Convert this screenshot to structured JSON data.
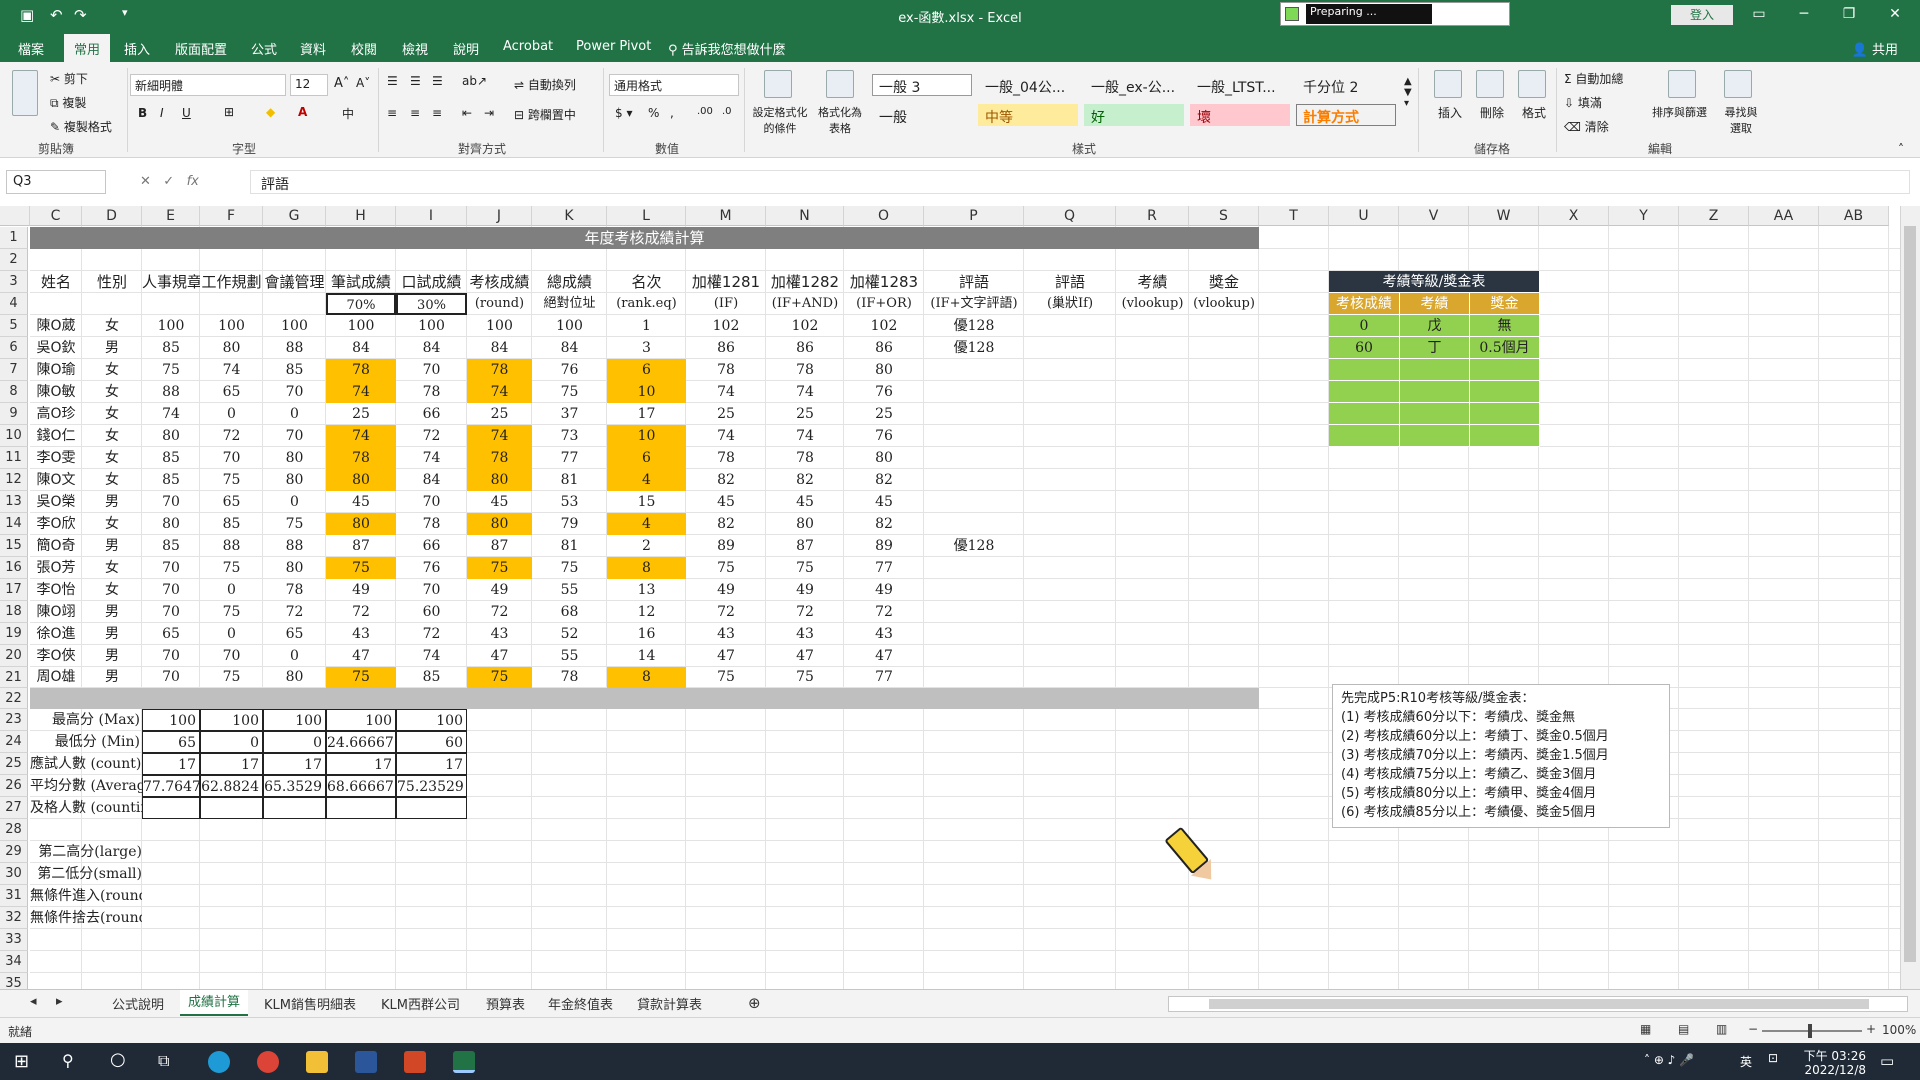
{
  "window": {
    "title": "ex-函數.xlsx  -  Excel",
    "preparing": "Preparing ...",
    "signin": "登入"
  },
  "menu": [
    "檔案",
    "常用",
    "插入",
    "版面配置",
    "公式",
    "資料",
    "校閱",
    "檢視",
    "說明",
    "Acrobat",
    "Power Pivot"
  ],
  "tell_me": "告訴我您想做什麼",
  "share": "共用",
  "ribbon": {
    "clipboard": {
      "cut": "剪下",
      "copy": "複製",
      "format_painter": "複製格式",
      "label": "剪貼簿"
    },
    "font": {
      "name": "新細明體",
      "size": "12",
      "label": "字型"
    },
    "alignment": {
      "wrap": "自動換列",
      "merge": "跨欄置中",
      "label": "對齊方式"
    },
    "number": {
      "format": "通用格式",
      "label": "數值"
    },
    "styles": {
      "cond": "設定格式化的條件",
      "table": "格式化為表格",
      "label": "樣式",
      "items": [
        "一般 3",
        "一般_04公...",
        "一般_ex-公...",
        "一般_LTST...",
        "千分位 2",
        "一般",
        "中等",
        "好",
        "壞",
        "計算方式"
      ]
    },
    "cells": {
      "insert": "插入",
      "delete": "刪除",
      "format": "格式",
      "label": "儲存格"
    },
    "editing": {
      "autosum": "自動加總",
      "fill": "填滿",
      "clear": "清除",
      "sort": "排序與篩選",
      "find": "尋找與選取",
      "label": "編輯"
    }
  },
  "formula_bar": {
    "name_box": "Q3",
    "content": "評語"
  },
  "columns": [
    "C",
    "D",
    "E",
    "F",
    "G",
    "H",
    "I",
    "J",
    "K",
    "L",
    "M",
    "N",
    "O",
    "P",
    "Q",
    "R",
    "S",
    "T",
    "U",
    "V",
    "W",
    "X",
    "Y",
    "Z",
    "AA",
    "AB"
  ],
  "rows": [
    "1",
    "2",
    "3",
    "4",
    "5",
    "6",
    "7",
    "8",
    "9",
    "10",
    "11",
    "12",
    "13",
    "14",
    "15",
    "16",
    "17",
    "18",
    "19",
    "20",
    "21",
    "22",
    "23",
    "24",
    "25",
    "26",
    "27",
    "28",
    "29",
    "30",
    "31",
    "32",
    "33",
    "34",
    "35"
  ],
  "sheet": {
    "title": "年度考核成績計算",
    "header1": [
      "姓名",
      "性別",
      "人事規章",
      "工作規劃",
      "會議管理",
      "筆試成績",
      "口試成績",
      "考核成績",
      "總成績",
      "名次",
      "加權1281",
      "加權1282",
      "加權1283",
      "評語",
      "評語",
      "考績",
      "獎金"
    ],
    "header2": [
      "",
      "",
      "",
      "",
      "",
      "70%",
      "30%",
      "(round)",
      "絕對位址",
      "(rank.eq)",
      "(IF)",
      "(IF+AND)",
      "(IF+OR)",
      "(IF+文字評語)",
      "(巢狀If)",
      "(vlookup)",
      "(vlookup)"
    ],
    "data": [
      [
        "陳O葳",
        "女",
        "100",
        "100",
        "100",
        "100",
        "100",
        "100",
        "100",
        "1",
        "102",
        "102",
        "102",
        "優128"
      ],
      [
        "吳O欽",
        "男",
        "85",
        "80",
        "88",
        "84",
        "84",
        "84",
        "84",
        "3",
        "86",
        "86",
        "86",
        "優128"
      ],
      [
        "陳O瑜",
        "女",
        "75",
        "74",
        "85",
        "78",
        "70",
        "78",
        "76",
        "6",
        "78",
        "78",
        "80",
        ""
      ],
      [
        "陳O敏",
        "女",
        "88",
        "65",
        "70",
        "74",
        "78",
        "74",
        "75",
        "10",
        "74",
        "74",
        "76",
        ""
      ],
      [
        "高O珍",
        "女",
        "74",
        "0",
        "0",
        "25",
        "66",
        "25",
        "37",
        "17",
        "25",
        "25",
        "25",
        ""
      ],
      [
        "錢O仁",
        "女",
        "80",
        "72",
        "70",
        "74",
        "72",
        "74",
        "73",
        "10",
        "74",
        "74",
        "76",
        ""
      ],
      [
        "李O雯",
        "女",
        "85",
        "70",
        "80",
        "78",
        "74",
        "78",
        "77",
        "6",
        "78",
        "78",
        "80",
        ""
      ],
      [
        "陳O文",
        "女",
        "85",
        "75",
        "80",
        "80",
        "84",
        "80",
        "81",
        "4",
        "82",
        "82",
        "82",
        ""
      ],
      [
        "吳O榮",
        "男",
        "70",
        "65",
        "0",
        "45",
        "70",
        "45",
        "53",
        "15",
        "45",
        "45",
        "45",
        ""
      ],
      [
        "李O欣",
        "女",
        "80",
        "85",
        "75",
        "80",
        "78",
        "80",
        "79",
        "4",
        "82",
        "80",
        "82",
        ""
      ],
      [
        "簡O奇",
        "男",
        "85",
        "88",
        "88",
        "87",
        "66",
        "87",
        "81",
        "2",
        "89",
        "87",
        "89",
        "優128"
      ],
      [
        "張O芳",
        "女",
        "70",
        "75",
        "80",
        "75",
        "76",
        "75",
        "75",
        "8",
        "75",
        "75",
        "77",
        ""
      ],
      [
        "李O怡",
        "女",
        "70",
        "0",
        "78",
        "49",
        "70",
        "49",
        "55",
        "13",
        "49",
        "49",
        "49",
        ""
      ],
      [
        "陳O翊",
        "男",
        "70",
        "75",
        "72",
        "72",
        "60",
        "72",
        "68",
        "12",
        "72",
        "72",
        "72",
        ""
      ],
      [
        "徐O進",
        "男",
        "65",
        "0",
        "65",
        "43",
        "72",
        "43",
        "52",
        "16",
        "43",
        "43",
        "43",
        ""
      ],
      [
        "李O俠",
        "男",
        "70",
        "70",
        "0",
        "47",
        "74",
        "47",
        "55",
        "14",
        "47",
        "47",
        "47",
        ""
      ],
      [
        "周O雄",
        "男",
        "70",
        "75",
        "80",
        "75",
        "85",
        "75",
        "78",
        "8",
        "75",
        "75",
        "77",
        ""
      ]
    ],
    "stats_labels": [
      "最高分 (Max)",
      "最低分 (Min)",
      "應試人數 (count)",
      "平均分數 (Average)",
      "及格人數 (countif)"
    ],
    "stats": [
      [
        "100",
        "100",
        "100",
        "100",
        "100"
      ],
      [
        "65",
        "0",
        "0",
        "24.66667",
        "60"
      ],
      [
        "17",
        "17",
        "17",
        "17",
        "17"
      ],
      [
        "77.7647",
        "62.8824",
        "65.3529",
        "68.66667",
        "75.23529"
      ],
      [
        "",
        "",
        "",
        "",
        ""
      ]
    ],
    "extra_labels": [
      "第二高分(large)",
      "第二低分(small)",
      "無條件進入(roundup)",
      "無條件捨去(rounddown)"
    ]
  },
  "grade_table": {
    "title": "考績等級/獎金表",
    "headers": [
      "考核成績",
      "考績",
      "獎金"
    ],
    "rows": [
      [
        "0",
        "戊",
        "無"
      ],
      [
        "60",
        "丁",
        "0.5個月"
      ],
      [
        "",
        "",
        ""
      ],
      [
        "",
        "",
        ""
      ],
      [
        "",
        "",
        ""
      ],
      [
        "",
        "",
        ""
      ]
    ]
  },
  "note": [
    "先完成P5:R10考核等級/獎金表：",
    "(1) 考核成績60分以下：考績戊、獎金無",
    "(2) 考核成績60分以上：考績丁、獎金0.5個月",
    "(3) 考核成績70分以上：考績丙、獎金1.5個月",
    "(4) 考核成績75分以上：考績乙、獎金3個月",
    "(5) 考核成績80分以上：考績甲、獎金4個月",
    "(6) 考核成績85分以上：考績優、獎金5個月"
  ],
  "tabs": [
    "公式說明",
    "成績計算",
    "KLM銷售明細表",
    "KLM西群公司",
    "預算表",
    "年金終值表",
    "貸款計算表"
  ],
  "active_tab": "成績計算",
  "status": {
    "ready": "就緒",
    "zoom": "100%"
  },
  "taskbar": {
    "time": "下午 03:26",
    "date": "2022/12/8",
    "ime": "英"
  },
  "colors": {
    "excel_green": "#217346",
    "highlight": "#ffc000",
    "header_dark": "#2b3542",
    "grade_green": "#92d050",
    "title_gray": "#7f7f7f"
  }
}
